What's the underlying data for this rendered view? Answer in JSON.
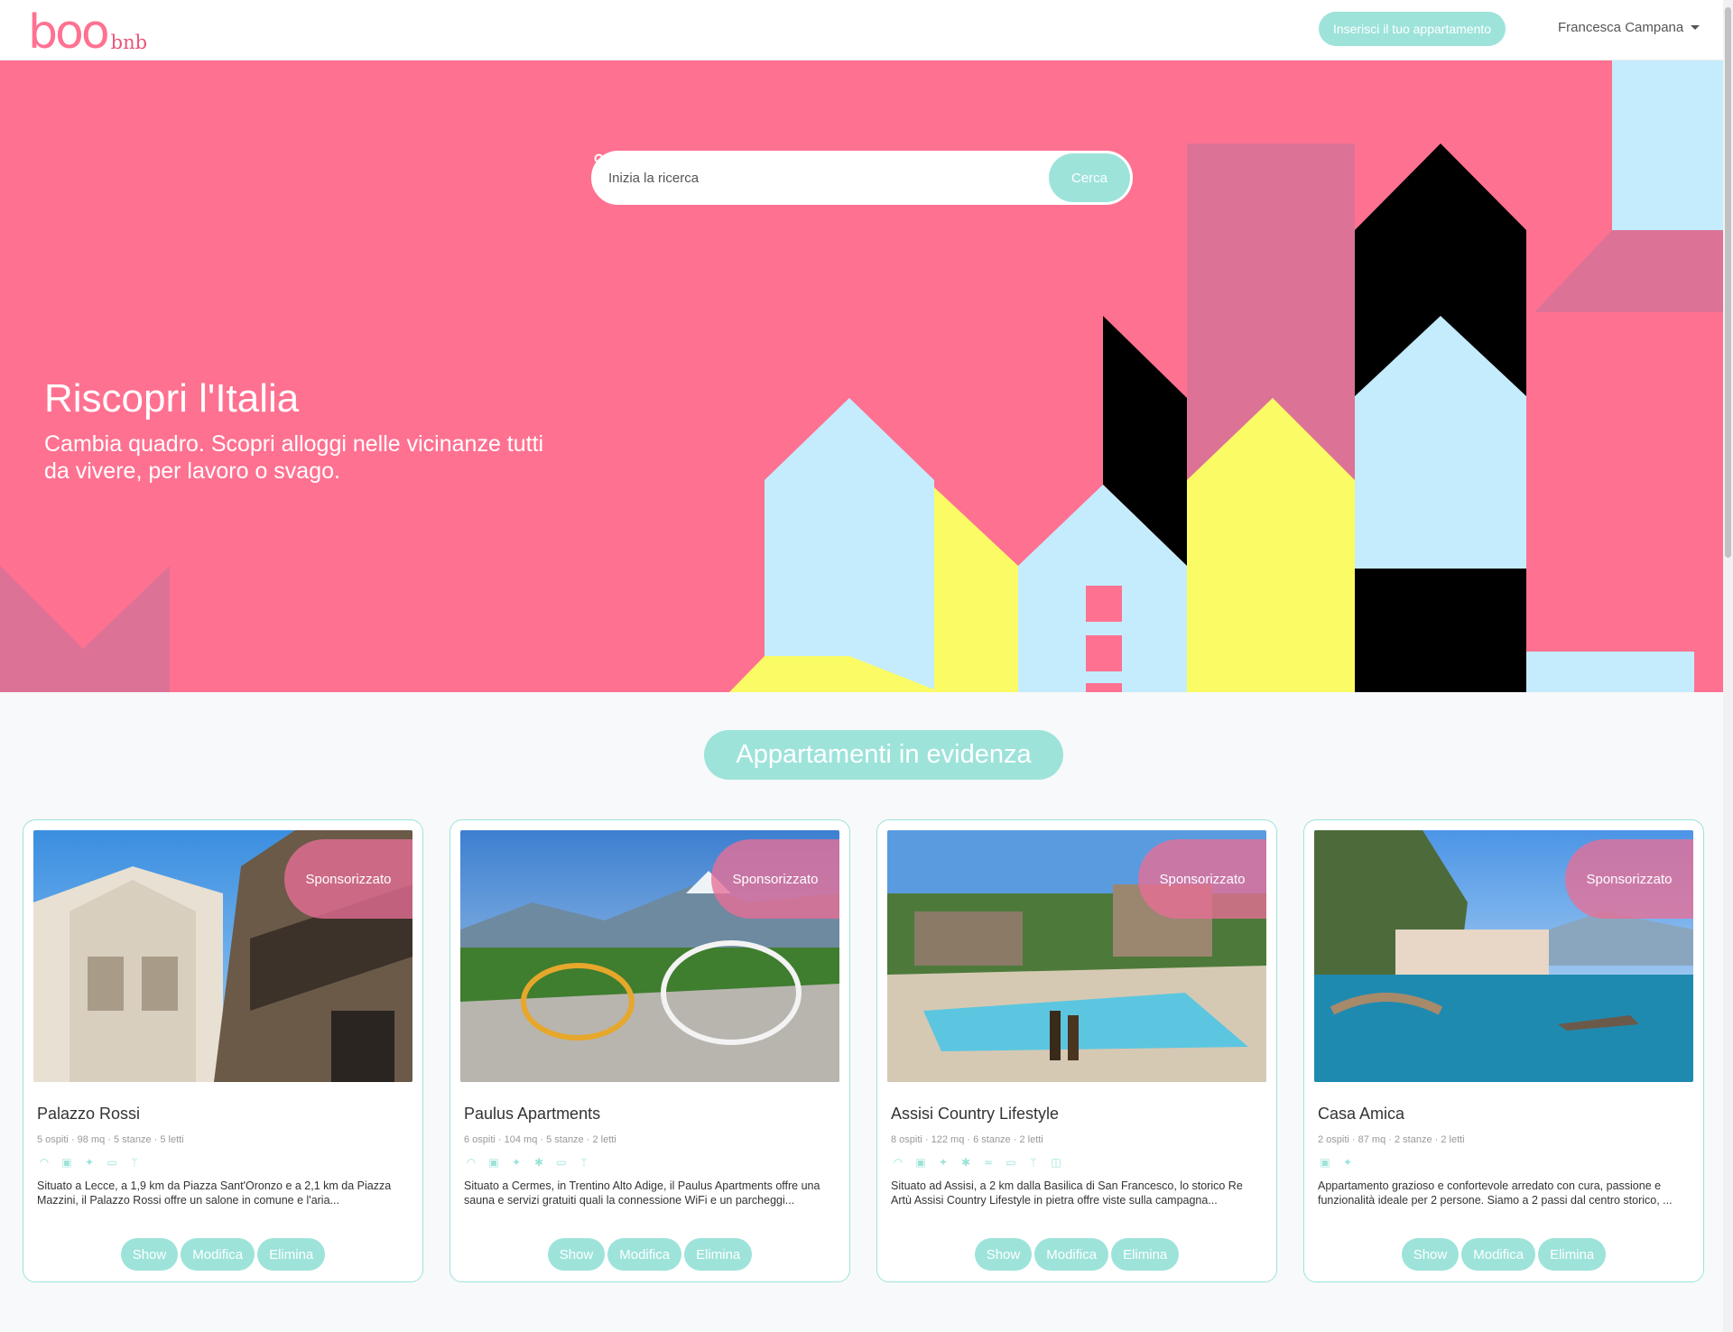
{
  "navbar": {
    "logo_main": "boo",
    "logo_sub": "bnb",
    "insert_label": "Inserisci il tuo appartamento",
    "user_name": "Francesca Campana"
  },
  "hero": {
    "search_placeholder": "Inizia la ricerca",
    "search_button": "Cerca",
    "title": "Riscopri l'Italia",
    "subtitle": "Cambia quadro. Scopri alloggi nelle vicinanze tutti da vivere, per lavoro o svago."
  },
  "section": {
    "title": "Appartamenti in evidenza"
  },
  "colors": {
    "accent": "#9de3da",
    "brand_pink": "#ff7191"
  },
  "cards": [
    {
      "title": "Palazzo Rossi",
      "badge": "Sponsorizzato",
      "meta": "5 ospiti · 98 mq · 5 stanze · 5 letti",
      "amenities": [
        "wifi-icon",
        "parking-icon",
        "pets-icon",
        "tv-icon",
        "kitchen-icon"
      ],
      "description": "Situato a Lecce, a 1,9 km da Piazza Sant'Oronzo e a 2,1 km da Piazza Mazzini, il Palazzo Rossi offre un salone in comune e l'aria...",
      "buttons": {
        "show": "Show",
        "edit": "Modifica",
        "delete": "Elimina"
      }
    },
    {
      "title": "Paulus Apartments",
      "badge": "Sponsorizzato",
      "meta": "6 ospiti · 104 mq · 5 stanze · 2 letti",
      "amenities": [
        "wifi-icon",
        "parking-icon",
        "pets-icon",
        "ac-icon",
        "tv-icon",
        "kitchen-icon"
      ],
      "description": "Situato a Cermes, in Trentino Alto Adige, il Paulus Apartments offre una sauna e servizi gratuiti quali la connessione WiFi e un parcheggi...",
      "buttons": {
        "show": "Show",
        "edit": "Modifica",
        "delete": "Elimina"
      }
    },
    {
      "title": "Assisi Country Lifestyle",
      "badge": "Sponsorizzato",
      "meta": "8 ospiti · 122 mq · 6 stanze · 2 letti",
      "amenities": [
        "wifi-icon",
        "parking-icon",
        "pets-icon",
        "ac-icon",
        "pool-icon",
        "tv-icon",
        "kitchen-icon",
        "breakfast-icon"
      ],
      "description": "Situato ad Assisi, a 2 km dalla Basilica di San Francesco, lo storico Re Artù Assisi Country Lifestyle in pietra offre viste sulla campagna...",
      "buttons": {
        "show": "Show",
        "edit": "Modifica",
        "delete": "Elimina"
      }
    },
    {
      "title": "Casa Amica",
      "badge": "Sponsorizzato",
      "meta": "2 ospiti · 87 mq · 2 stanze · 2 letti",
      "amenities": [
        "parking-icon",
        "pets-icon"
      ],
      "description": "Appartamento grazioso e confortevole arredato con cura, passione e funzionalità ideale per 2 persone. Siamo a 2 passi dal centro storico, ...",
      "buttons": {
        "show": "Show",
        "edit": "Modifica",
        "delete": "Elimina"
      }
    }
  ]
}
